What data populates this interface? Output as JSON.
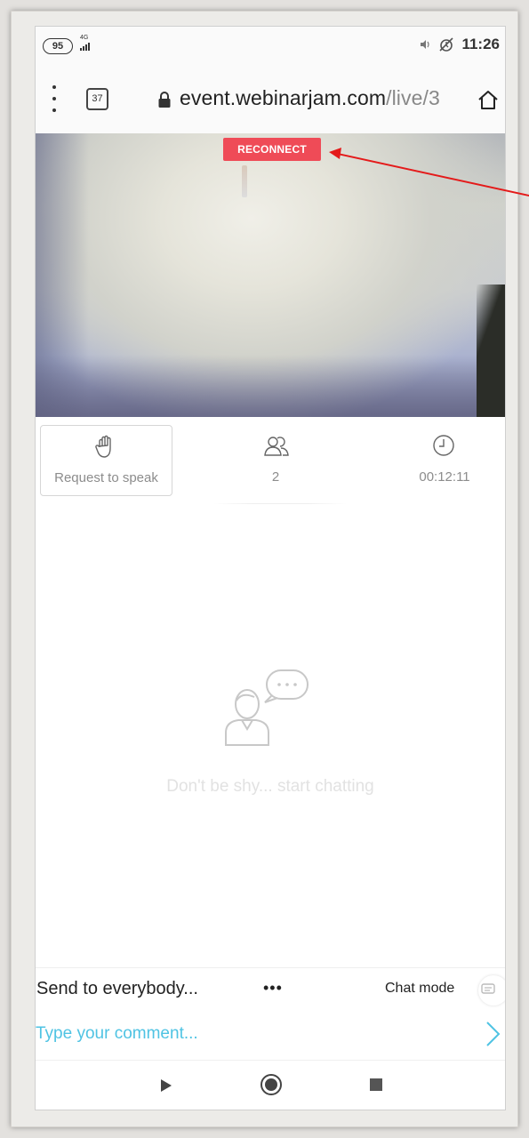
{
  "status_bar": {
    "battery": "95",
    "network": "4G",
    "time": "11:26",
    "icons": [
      "volume-icon",
      "alarm-off-icon"
    ]
  },
  "browser": {
    "tab_count": "37",
    "url_host": "event.webinarjam.com",
    "url_path": "/live/3",
    "icons": [
      "menu-dots-icon",
      "lock-icon",
      "home-icon"
    ]
  },
  "video": {
    "reconnect_label": "RECONNECT"
  },
  "controls": {
    "request_to_speak": "Request to speak",
    "attendees_count": "2",
    "elapsed_time": "00:12:11",
    "icons": [
      "raise-hand-icon",
      "attendees-icon",
      "clock-icon"
    ]
  },
  "chat": {
    "empty_message": "Don't be shy... start chatting",
    "send_to": "Send to everybody...",
    "more_label": "•••",
    "chat_mode_label": "Chat mode",
    "comment_placeholder": "Type your comment...",
    "icons": [
      "chat-empty-icon",
      "chat-mode-icon",
      "send-arrow-icon"
    ]
  },
  "colors": {
    "reconnect_bg": "#ef4b57",
    "accent": "#4fc3e3",
    "annotation_arrow": "#e41a1a",
    "muted_text": "#8c8c8c"
  }
}
